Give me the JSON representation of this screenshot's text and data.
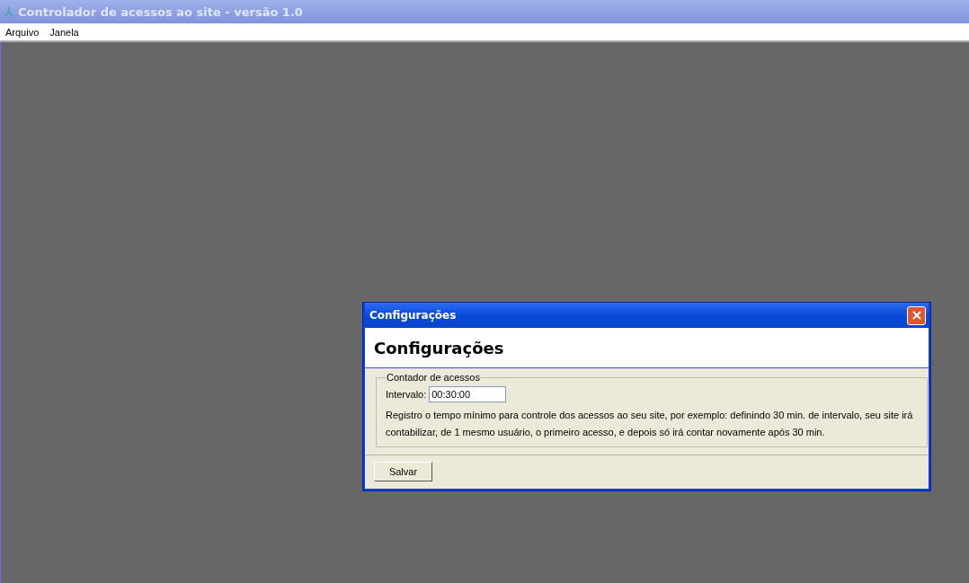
{
  "window": {
    "title": "Controlador de acessos ao site - versão 1.0"
  },
  "menu": [
    "Arquivo",
    "Janela"
  ],
  "dialog": {
    "title": "Configurações",
    "heading": "Configurações",
    "group_label": "Contador de acessos",
    "field_label": "Intervalo:",
    "field_value": "00:30:00",
    "description": "Registro o tempo mínimo para controle dos acessos ao seu site, por exemplo: definindo 30 min. de intervalo, seu site irá contabilizar, de 1 mesmo usuário, o primeiro acesso, e depois só irá contar novamente após 30 min.",
    "button": "Salvar"
  }
}
